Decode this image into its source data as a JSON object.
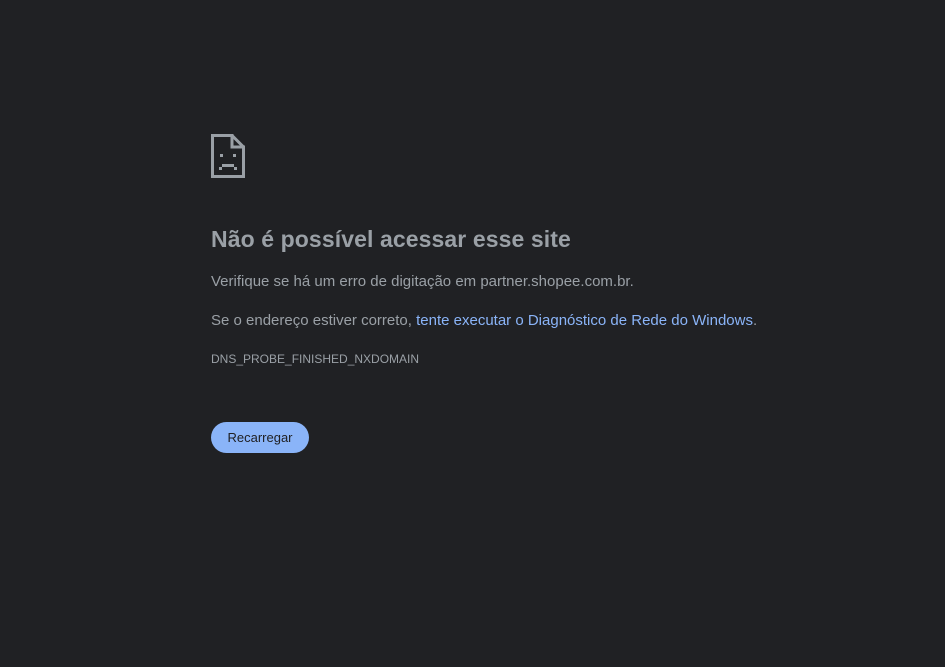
{
  "error": {
    "icon": "sad-page-icon",
    "title": "Não é possível acessar esse site",
    "typo_message": "Verifique se há um erro de digitação em partner.shopee.com.br.",
    "address_prefix": "Se o endereço estiver correto, ",
    "diagnostic_link": "tente executar o Diagnóstico de Rede do Windows",
    "address_suffix": ".",
    "error_code": "DNS_PROBE_FINISHED_NXDOMAIN",
    "reload_button": "Recarregar"
  },
  "colors": {
    "background": "#202124",
    "text": "#9aa0a6",
    "link": "#8ab4f8",
    "button": "#8ab4f8"
  }
}
